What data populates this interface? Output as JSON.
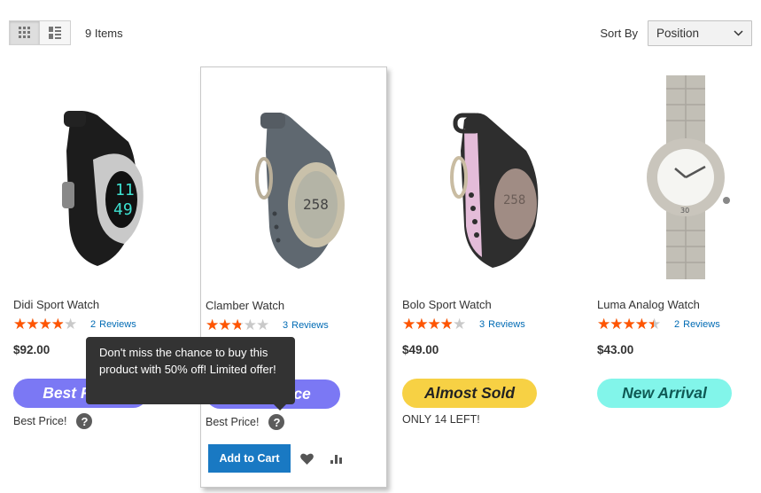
{
  "toolbar": {
    "view_modes": [
      {
        "name": "grid",
        "icon": "grid-icon",
        "active": true
      },
      {
        "name": "list",
        "icon": "list-icon",
        "active": false
      }
    ],
    "item_count": "9 Items",
    "sort_label": "Sort By",
    "sort_value": "Position"
  },
  "products": [
    {
      "name": "Didi Sport Watch",
      "rating_percent": 70,
      "review_count": "2",
      "review_label": "Reviews",
      "price": "$92.00",
      "badge": {
        "label": "Best Price",
        "bg": "#7b78f4",
        "color": "#ffffff"
      },
      "note": "Best Price!",
      "has_help": true
    },
    {
      "name": "Clamber Watch",
      "rating_percent": 50,
      "review_count": "3",
      "review_label": "Reviews",
      "price": "",
      "badge": {
        "label": "Best Price",
        "bg": "#7b78f4",
        "color": "#ffffff"
      },
      "note": "Best Price!",
      "has_help": true,
      "hovered": true,
      "add_to_cart": "Add to Cart"
    },
    {
      "name": "Bolo Sport Watch",
      "rating_percent": 70,
      "review_count": "3",
      "review_label": "Reviews",
      "price": "$49.00",
      "badge": {
        "label": "Almost Sold",
        "bg": "#f7d144",
        "color": "#222222"
      },
      "note": "ONLY 14 LEFT!",
      "has_help": false
    },
    {
      "name": "Luma Analog Watch",
      "rating_percent": 80,
      "review_count": "2",
      "review_label": "Reviews",
      "price": "$43.00",
      "badge": {
        "label": "New Arrival",
        "bg": "#82f5ea",
        "color": "#0f5a55"
      },
      "note": "",
      "has_help": false
    }
  ],
  "tooltip": {
    "text": "Don't miss the chance to buy this product with 50% off! Limited offer!"
  },
  "colors": {
    "accent_blue": "#1979c3",
    "star_filled": "#ff5501",
    "star_empty": "#c9c9c9",
    "link": "#006bb4"
  }
}
